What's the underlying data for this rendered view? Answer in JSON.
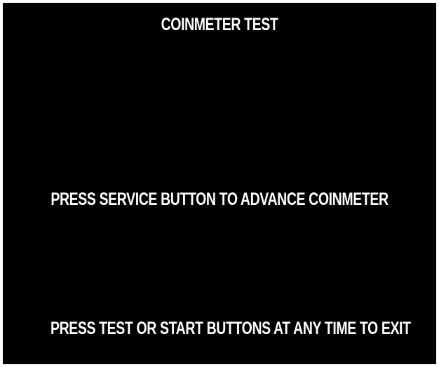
{
  "screen": {
    "title": "COINMETER TEST",
    "instruction": "PRESS SERVICE BUTTON TO ADVANCE COINMETER",
    "exit_hint": "PRESS TEST OR START BUTTONS AT ANY TIME TO EXIT"
  },
  "colors": {
    "background": "#000000",
    "text": "#ffffff",
    "frame": "#ffffff"
  }
}
